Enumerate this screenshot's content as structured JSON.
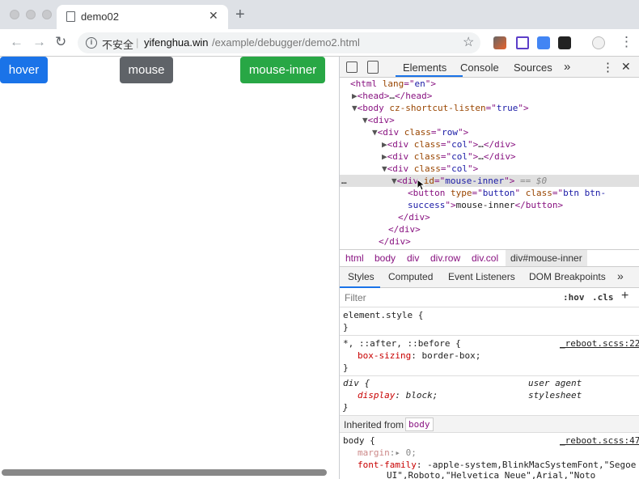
{
  "browser": {
    "tab_title": "demo02",
    "tab_close": "✕",
    "new_tab": "+",
    "back": "←",
    "forward": "→",
    "reload": "↻",
    "info": "i",
    "insecure_label": "不安全",
    "separator": "|",
    "url_host": "yifenghua.win",
    "url_path": "/example/debugger/demo2.html",
    "star": "☆",
    "menu": "⋮"
  },
  "page": {
    "buttons": [
      {
        "label": "hover",
        "color": "#1a73e8"
      },
      {
        "label": "mouse",
        "color": "#5f6368"
      },
      {
        "label": "mouse-inner",
        "color": "#28a745"
      }
    ]
  },
  "devtools": {
    "tabs": [
      "Elements",
      "Console",
      "Sources",
      "»"
    ],
    "close": "✕",
    "more": "⋮",
    "tree": {
      "l1": [
        "<html ",
        "lang",
        "=\"",
        "en",
        "\">"
      ],
      "l2": [
        "▶",
        "<head>",
        "…",
        "</head>"
      ],
      "l3": [
        "▼",
        "<body ",
        "cz-shortcut-listen",
        "=\"",
        "true",
        "\">"
      ],
      "l4": [
        "▼",
        "<div>"
      ],
      "l5": [
        "▼",
        "<div ",
        "class",
        "=\"",
        "row",
        "\">"
      ],
      "l6": [
        "▶",
        "<div ",
        "class",
        "=\"",
        "col",
        "\">",
        "…",
        "</div>"
      ],
      "l7": [
        "▶",
        "<div ",
        "class",
        "=\"",
        "col",
        "\">",
        "…",
        "</div>"
      ],
      "l8": [
        "▼",
        "<div ",
        "class",
        "=\"",
        "col",
        "\">"
      ],
      "l9": [
        "…",
        "▼",
        "<div ",
        "id",
        "=\"",
        "mouse-inner",
        "\">",
        " == $0"
      ],
      "l10": [
        "<button ",
        "type",
        "=\"",
        "button",
        "\" ",
        "class",
        "=\"",
        "btn btn-"
      ],
      "l11": [
        "success",
        "\">",
        "mouse-inner",
        "</button>"
      ],
      "l12": "</div>",
      "l13": "</div>",
      "l14": "</div>"
    },
    "breadcrumbs": [
      "html",
      "body",
      "div",
      "div.row",
      "div.col",
      "div#mouse-inner"
    ],
    "styles_tabs": [
      "Styles",
      "Computed",
      "Event Listeners",
      "DOM Breakpoints",
      "»"
    ],
    "filter_placeholder": "Filter",
    "hov": ":hov",
    "cls": ".cls",
    "plus": "+",
    "rules": {
      "r1_sel": "element.style {",
      "r1_end": "}",
      "r2_sel": "*, ::after, ::before {",
      "r2_src": "_reboot.scss:22",
      "r2_prop": "box-sizing",
      "r2_val": ": border-box;",
      "r2_end": "}",
      "r3_sel": "div {",
      "r3_src": "user agent stylesheet",
      "r3_prop": "display",
      "r3_val": ": block;",
      "r3_end": "}",
      "inherited_label": "Inherited from",
      "inherited_tag": "body",
      "r4_sel": "body {",
      "r4_src": "_reboot.scss:47",
      "r4_prop1": "margin",
      "r4_val1": ":▸ 0;",
      "r4_prop2": "font-family",
      "r4_val2": ": -apple-system,BlinkMacSystemFont,\"Segoe",
      "r4_val3": "UI\",Roboto,\"Helvetica Neue\",Arial,\"Noto"
    }
  }
}
